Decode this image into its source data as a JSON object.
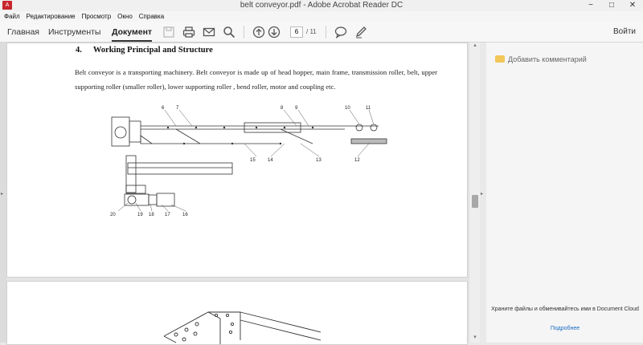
{
  "window": {
    "title": "belt conveyor.pdf - Adobe Acrobat Reader DC",
    "controls": {
      "minimize": "−",
      "maximize": "□",
      "close": "✕"
    }
  },
  "menu": [
    "Файл",
    "Редактирование",
    "Просмотр",
    "Окно",
    "Справка"
  ],
  "tabs": [
    {
      "label": "Главная",
      "active": false
    },
    {
      "label": "Инструменты",
      "active": false
    },
    {
      "label": "Документ",
      "active": true
    }
  ],
  "toolbar": {
    "icons": [
      "save-icon",
      "print-icon",
      "email-icon",
      "search-icon",
      "page-up-icon",
      "page-down-icon",
      "comment-icon",
      "pen-icon"
    ],
    "page_current": "6",
    "page_total": "/ 11",
    "login_label": "Войти"
  },
  "document": {
    "heading_number": "4.",
    "heading_text": "Working Principal and Structure",
    "paragraph": "Belt conveyor is a transporting machinery. Belt conveyor is made up of head hopper, main frame, transmission roller, belt, upper supporting roller (smaller roller), lower supporting roller , bend roller, motor and coupling etc.",
    "figure_labels": [
      "6",
      "7",
      "8",
      "9",
      "10",
      "11",
      "15",
      "14",
      "13",
      "12",
      "20",
      "19",
      "18",
      "17",
      "16"
    ]
  },
  "right_pane": {
    "add_comment": "Добавить комментарий",
    "cloud_text": "Храните файлы и обменивайтесь ими в Document Cloud",
    "more_link": "Подробнее"
  },
  "colors": {
    "accent": "#1a6bc5",
    "acrobat_red": "#c8262d",
    "comment_yellow": "#f2c75a"
  }
}
